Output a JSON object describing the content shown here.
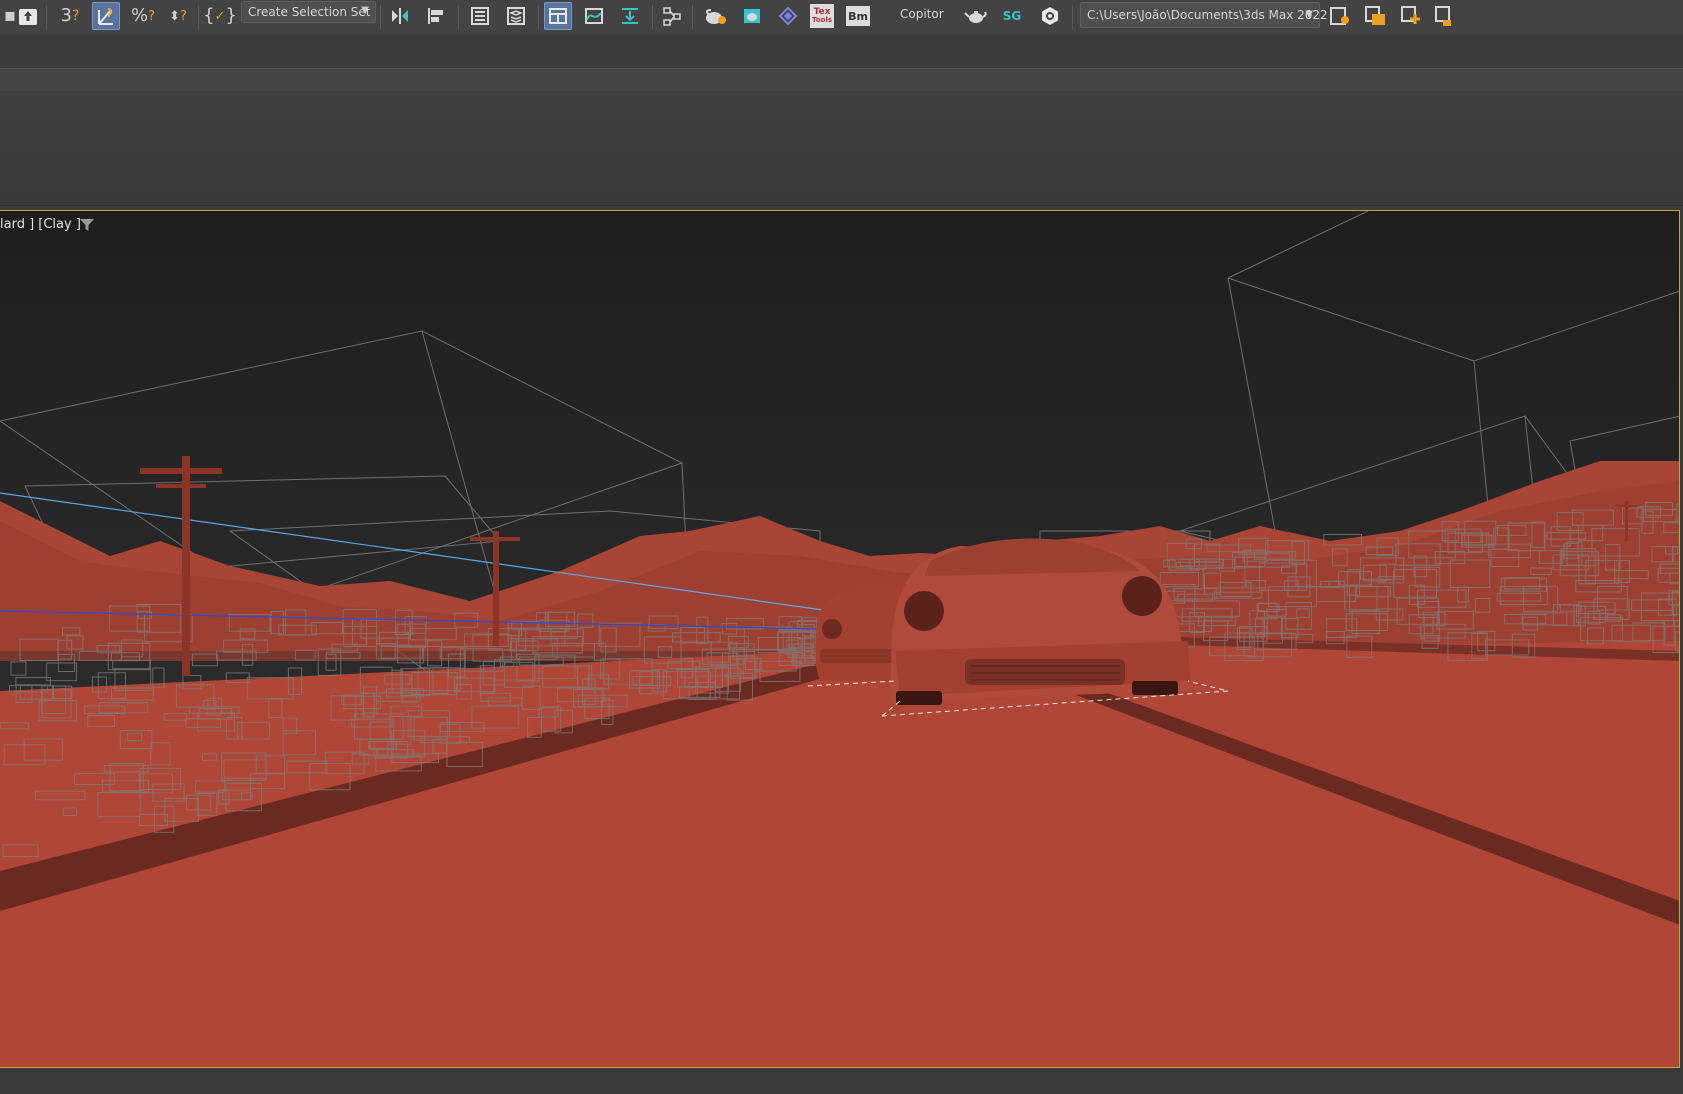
{
  "toolbar": {
    "selection_set_dropdown": {
      "label": "Create Selection Set"
    },
    "text_icons": {
      "tex_top": "Tex",
      "tex_bottom": "Tools",
      "bm": "Bm"
    },
    "copitor_label": "Copitor",
    "sg_label": "SG",
    "project_path": "C:\\Users\\João\\Documents\\3ds Max 2022",
    "icons": [
      "select-object-icon",
      "angle-snap-icon",
      "snap-toggle-icon",
      "percent-snap-icon",
      "spinner-snap-icon",
      "edit-named-selection-icon",
      "mirror-icon",
      "align-icon",
      "scene-explorer-icon",
      "layer-explorer-icon",
      "toggle-ribbon-icon",
      "curve-editor-icon",
      "dope-sheet-icon",
      "schematic-view-icon",
      "render-setup-icon",
      "rendered-frame-window-icon",
      "material-editor-icon",
      "tex-tools-icon",
      "bm-icon",
      "teapot-render-icon",
      "sg-icon",
      "hexagon-plugin-icon",
      "project-folder-icon",
      "set-project-folder-icon",
      "open-project-icon"
    ]
  },
  "viewport": {
    "label": "lard ] [Clay ]",
    "shading": "Clay",
    "colors": {
      "clay": "#b34a3a",
      "clay_dark": "#6a2a22",
      "sky": "#262626",
      "wire": "#8a8a8a",
      "active_border": "#c9a623"
    }
  }
}
